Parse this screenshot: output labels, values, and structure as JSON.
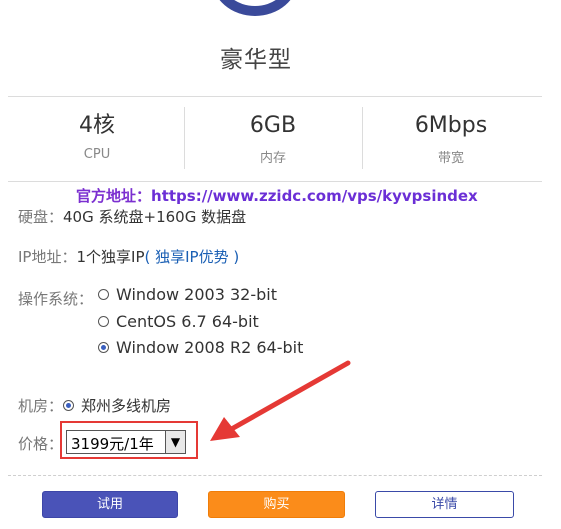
{
  "plan": {
    "title": "豪华型"
  },
  "specs": [
    {
      "value": "4核",
      "label": "CPU"
    },
    {
      "value": "6GB",
      "label": "内存"
    },
    {
      "value": "6Mbps",
      "label": "带宽"
    }
  ],
  "watermark": {
    "prefix": "官方地址：",
    "url": "https://www.zzidc.com/vps/kyvpsindex"
  },
  "disk": {
    "label": "硬盘：",
    "value": "40G 系统盘+160G 数据盘"
  },
  "ip": {
    "label": "IP地址：",
    "value": "1个独享IP",
    "link": "( 独享IP优势 )"
  },
  "os": {
    "label": "操作系统：",
    "options": [
      {
        "label": "Window 2003 32-bit",
        "selected": false
      },
      {
        "label": "CentOS 6.7 64-bit",
        "selected": false
      },
      {
        "label": "Window 2008 R2 64-bit",
        "selected": true
      }
    ]
  },
  "datacenter": {
    "label": "机房：",
    "value": "郑州多线机房",
    "selected": true
  },
  "price": {
    "label": "价格：",
    "selected": "3199元/1年"
  },
  "buttons": {
    "trial": "试用",
    "buy": "购买",
    "details": "详情"
  },
  "colors": {
    "primary": "#4a53b8",
    "buy": "#fb8c1a",
    "annotation": "#e53935",
    "watermark": "#7b2fd0"
  }
}
